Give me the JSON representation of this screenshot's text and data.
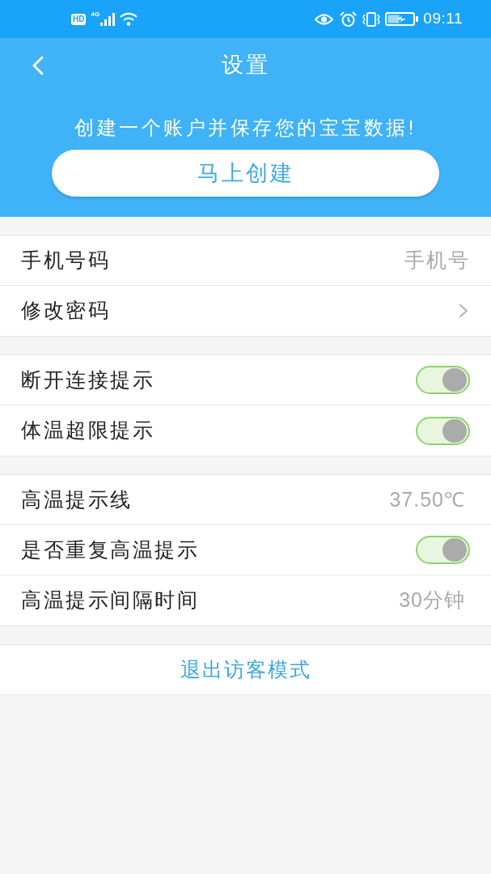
{
  "status_bar": {
    "hd_badge": "HD",
    "network_type": "4G",
    "time": "09:11"
  },
  "header": {
    "title": "设置",
    "prompt": "创建一个账户并保存您的宝宝数据!",
    "create_button": "马上创建"
  },
  "groups": [
    {
      "rows": [
        {
          "kind": "input",
          "label": "手机号码",
          "placeholder": "手机号"
        },
        {
          "kind": "link",
          "label": "修改密码"
        }
      ]
    },
    {
      "rows": [
        {
          "kind": "toggle",
          "label": "断开连接提示",
          "on": true
        },
        {
          "kind": "toggle",
          "label": "体温超限提示",
          "on": true
        }
      ]
    },
    {
      "rows": [
        {
          "kind": "value",
          "label": "高温提示线",
          "value": "37.50℃"
        },
        {
          "kind": "toggle",
          "label": "是否重复高温提示",
          "on": true
        },
        {
          "kind": "value",
          "label": "高温提示间隔时间",
          "value": "30分钟"
        }
      ]
    }
  ],
  "exit_button": "退出访客模式"
}
